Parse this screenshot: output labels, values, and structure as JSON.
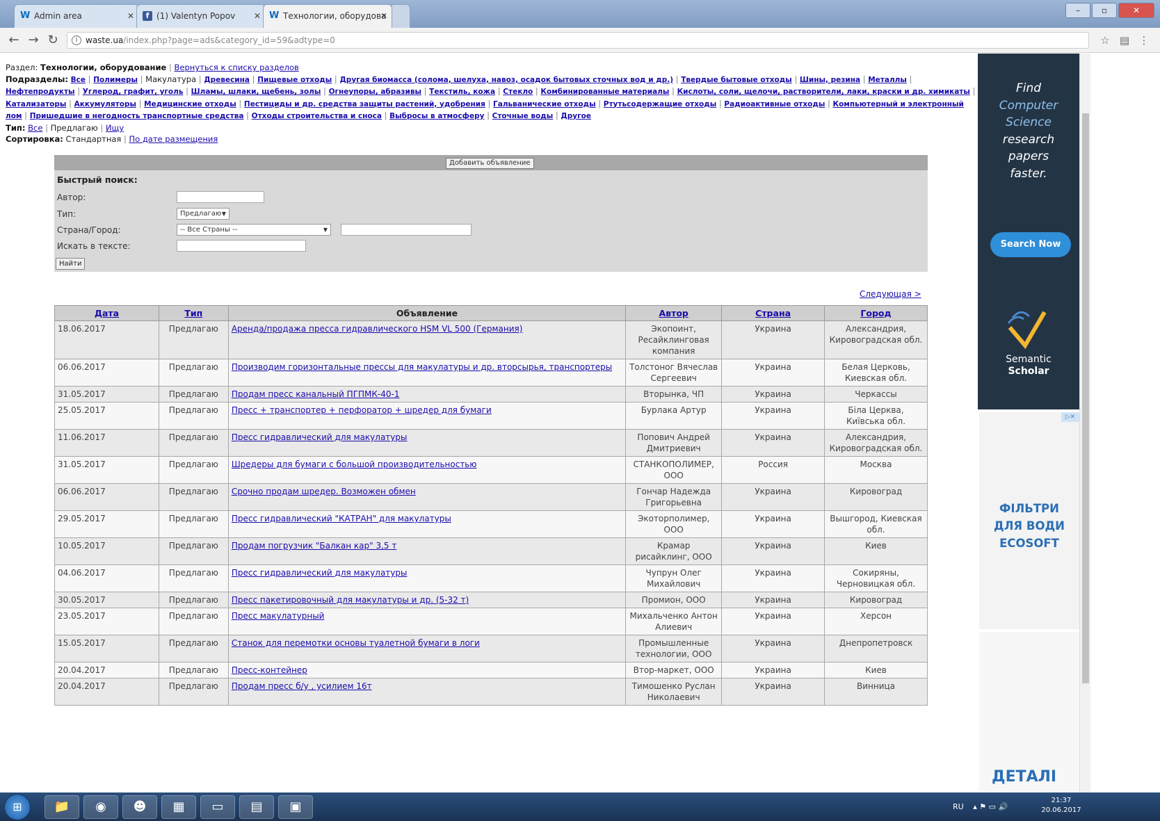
{
  "browser": {
    "tabs": [
      {
        "label": "Admin area",
        "favicon": "W"
      },
      {
        "label": "(1) Valentyn Popov",
        "favicon": "f"
      },
      {
        "label": "Технологии, оборудова",
        "favicon": "W"
      }
    ],
    "url_host": "waste.ua",
    "url_rest": "/index.php?page=ads&category_id=59&adtype=0"
  },
  "page": {
    "section_label": "Раздел:",
    "section_value": "Технологии, оборудование",
    "back_link": "Вернуться к списку разделов",
    "subsections_label": "Подразделы:",
    "subsections": [
      "Все",
      "Полимеры",
      "Макулатура",
      "Древесина",
      "Пищевые отходы",
      "Другая биомасса (солома, шелуха, навоз, осадок бытовых сточных вод и др.)",
      "Твердые бытовые отходы",
      "Шины, резина",
      "Металлы",
      "Нефтепродукты",
      "Углерод, графит, уголь",
      "Шламы, шлаки, щебень, золы",
      "Огнеупоры, абразивы",
      "Текстиль, кожа",
      "Стекло",
      "Комбинированные материалы",
      "Кислоты, соли, щелочи, растворители, лаки, краски и др. химикаты",
      "Катализаторы",
      "Аккумуляторы",
      "Медицинские отходы",
      "Пестициды и др. средства защиты растений, удобрения",
      "Гальванические отходы",
      "Ртутьсодержащие отходы",
      "Радиоактивные отходы",
      "Компьютерный и электронный лом",
      "Пришедшие в негодность транспортные средства",
      "Отходы строительства и сноса",
      "Выбросы в атмосферу",
      "Сточные воды",
      "Другое"
    ],
    "current_subsection": "Макулатура",
    "type_label": "Тип:",
    "type_all": "Все",
    "type_offer": "Предлагаю",
    "type_seek": "Ищу",
    "sort_label": "Сортировка:",
    "sort_standard": "Стандартная",
    "sort_by_date": "По дате размещения"
  },
  "search": {
    "add_button": "Добавить объявление",
    "title": "Быстрый поиск:",
    "author_label": "Автор:",
    "type_label": "Тип:",
    "type_value": "Предлагаю",
    "country_label": "Страна/Город:",
    "country_value": "-- Все Страны --",
    "text_label": "Искать в тексте:",
    "find_button": "Найти"
  },
  "next_link": "Следующая >",
  "table": {
    "headers": [
      "Дата",
      "Тип",
      "Объявление",
      "Автор",
      "Страна",
      "Город"
    ],
    "rows": [
      {
        "date": "18.06.2017",
        "type": "Предлагаю",
        "ad": "Аренда/продажа пресса гидравлического HSM VL 500 (Германия)",
        "author": "Экопоинт, Ресайклинговая компания",
        "country": "Украина",
        "city": "Александрия, Кировоградская обл."
      },
      {
        "date": "06.06.2017",
        "type": "Предлагаю",
        "ad": "Производим горизонтальные прессы для макулатуры и др. вторсырья, транспортеры",
        "author": "Толстоног Вячеслав Сергеевич",
        "country": "Украина",
        "city": "Белая Церковь, Киевская обл."
      },
      {
        "date": "31.05.2017",
        "type": "Предлагаю",
        "ad": "Продам пресс канальный ПГПМК-40-1",
        "author": "Вторынка, ЧП",
        "country": "Украина",
        "city": "Черкассы"
      },
      {
        "date": "25.05.2017",
        "type": "Предлагаю",
        "ad": "Пресс + транспортер + перфоратор + шредер для бумаги",
        "author": "Бурлака Артур",
        "country": "Украина",
        "city": "Біла Церква, Київська обл."
      },
      {
        "date": "11.06.2017",
        "type": "Предлагаю",
        "ad": "Пресс гидравлический для макулатуры",
        "author": "Попович Андрей Дмитриевич",
        "country": "Украина",
        "city": "Александрия, Кировоградская обл."
      },
      {
        "date": "31.05.2017",
        "type": "Предлагаю",
        "ad": "Шредеры для бумаги с большой производительностью",
        "author": "СТАНКОПОЛИМЕР, ООО",
        "country": "Россия",
        "city": "Москва"
      },
      {
        "date": "06.06.2017",
        "type": "Предлагаю",
        "ad": "Срочно продам шредер. Возможен обмен",
        "author": "Гончар Надежда Григорьевна",
        "country": "Украина",
        "city": "Кировоград"
      },
      {
        "date": "29.05.2017",
        "type": "Предлагаю",
        "ad": "Пресс гидравлический \"КАТРАН\" для макулатуры",
        "author": "Экоторполимер, ООО",
        "country": "Украина",
        "city": "Вышгород, Киевская обл."
      },
      {
        "date": "10.05.2017",
        "type": "Предлагаю",
        "ad": "Продам погрузчик \"Балкан кар\" 3,5 т",
        "author": "Крамар рисайклинг, ООО",
        "country": "Украина",
        "city": "Киев"
      },
      {
        "date": "04.06.2017",
        "type": "Предлагаю",
        "ad": "Пресс гидравлический для макулатуры",
        "author": "Чупрун Олег Михайлович",
        "country": "Украина",
        "city": "Сокиряны, Черновицкая обл."
      },
      {
        "date": "30.05.2017",
        "type": "Предлагаю",
        "ad": "Пресс пакетировочный для макулатуры и др. (5-32 т)",
        "author": "Промион, ООО",
        "country": "Украина",
        "city": "Кировоград"
      },
      {
        "date": "23.05.2017",
        "type": "Предлагаю",
        "ad": "Пресс макулатурный",
        "author": "Михальченко Антон Алиевич",
        "country": "Украина",
        "city": "Херсон"
      },
      {
        "date": "15.05.2017",
        "type": "Предлагаю",
        "ad": "Станок для перемотки основы туалетной бумаги в логи",
        "author": "Промышленные технологии, ООО",
        "country": "Украина",
        "city": "Днепропетровск"
      },
      {
        "date": "20.04.2017",
        "type": "Предлагаю",
        "ad": "Пресс-контейнер",
        "author": "Втор-маркет, ООО",
        "country": "Украина",
        "city": "Киев"
      },
      {
        "date": "20.04.2017",
        "type": "Предлагаю",
        "ad": "Продам пресс б/у , усилием 16т",
        "author": "Тимошенко Руслан Николаевич",
        "country": "Украина",
        "city": "Винница"
      }
    ]
  },
  "ads": {
    "ad1_line1": "Find",
    "ad1_line2": "Computer",
    "ad1_line3": "Science",
    "ad1_line4": "research",
    "ad1_line5": "papers",
    "ad1_line6": "faster.",
    "ad1_button": "Search Now",
    "ad1_brand1": "Semantic",
    "ad1_brand2": "Scholar",
    "ad2_line1": "ФІЛЬТРИ",
    "ad2_line2": "ДЛЯ ВОДИ",
    "ad2_line3": "ECOSOFT",
    "ad3_text": "ДЕТАЛІ"
  },
  "taskbar": {
    "lang": "RU",
    "time": "21:37",
    "date": "20.06.2017"
  }
}
